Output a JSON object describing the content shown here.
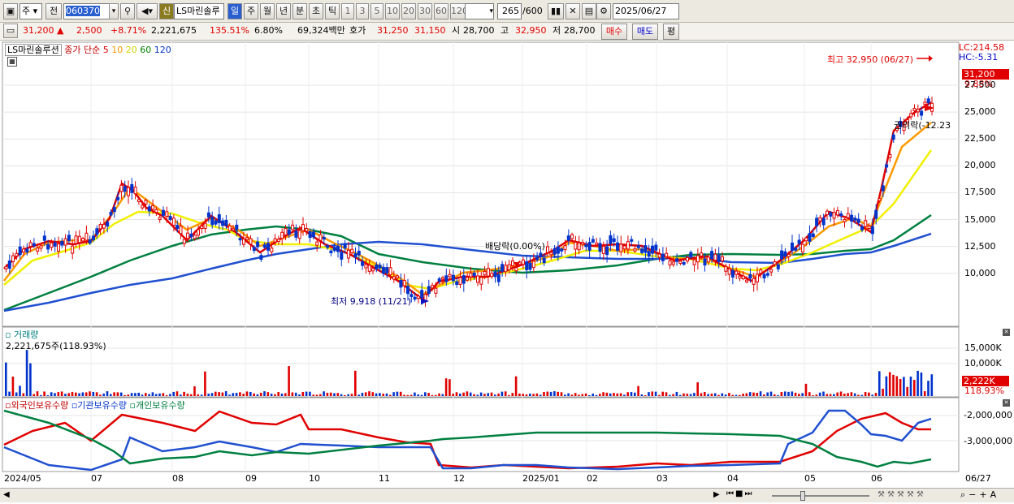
{
  "toolbar": {
    "period_select": "주",
    "prev_label": "전",
    "code_value": "060370",
    "badge_label": "신",
    "stock_name": "LS마린솔루",
    "period_day": "일",
    "period_week": "주",
    "period_month": "월",
    "period_year": "년",
    "period_minute": "분",
    "period_second": "초",
    "period_tick": "틱",
    "intervals": [
      "1",
      "3",
      "5",
      "10",
      "20",
      "30",
      "60",
      "120"
    ],
    "count_value": "265",
    "count_total": "/600",
    "date_value": "2025/06/27"
  },
  "quote": {
    "price": "31,200",
    "change": "2,500",
    "change_pct": "+8.71%",
    "volume": "2,221,675",
    "volume_ratio": "135.51%",
    "turnover": "6.80%",
    "amount": "69,324백만",
    "hoga_label": "호가",
    "ask": "31,250",
    "bid": "31,150",
    "open_label": "시",
    "open": "28,700",
    "high_label": "고",
    "high": "32,950",
    "low_label": "저",
    "low": "28,700",
    "buy_label": "매수",
    "sell_label": "매도",
    "eval_label": "평"
  },
  "price_panel": {
    "name": "LS마린솔루션",
    "legend_prefix": "종가 단순",
    "ma_periods": [
      "5",
      "10",
      "20",
      "60",
      "120"
    ],
    "ma_colors": [
      "#e00000",
      "#ff9900",
      "#e8e800",
      "#008000",
      "#0033cc"
    ],
    "lc_label": "LC:214.58",
    "hc_label": "HC:-5.31",
    "current_tag": "31,200",
    "pct_tag": "9.88%",
    "high_annot": "최고 32,950 (06/27)",
    "low_annot": "최저 9,918 (11/21)",
    "dividend_annot": "배당락(0.00%)",
    "rights_annot": "권리락(-12.23",
    "y_ticks": [
      "27,500",
      "25,000",
      "22,500",
      "20,000",
      "17,500",
      "15,000",
      "12,500",
      "10,000"
    ]
  },
  "volume_panel": {
    "title": "거래량",
    "value": "2,221,675주(118.93%)",
    "y_ticks": [
      "15,000K",
      "10,000K"
    ],
    "tag_value": "2,222K",
    "tag_pct": "118.93%"
  },
  "holdings_panel": {
    "series": [
      "외국인보유수량",
      "기관보유수량",
      "개인보유수량"
    ],
    "series_colors": [
      "#e00000",
      "#0033cc",
      "#008040"
    ],
    "y_ticks": [
      "-2,000,000",
      "-3,000,000"
    ]
  },
  "x_axis": {
    "labels": [
      "2024/05",
      "07",
      "08",
      "09",
      "10",
      "11",
      "12",
      "2025/01",
      "02",
      "03",
      "04",
      "05",
      "06"
    ],
    "end_label": "06/27"
  }
}
